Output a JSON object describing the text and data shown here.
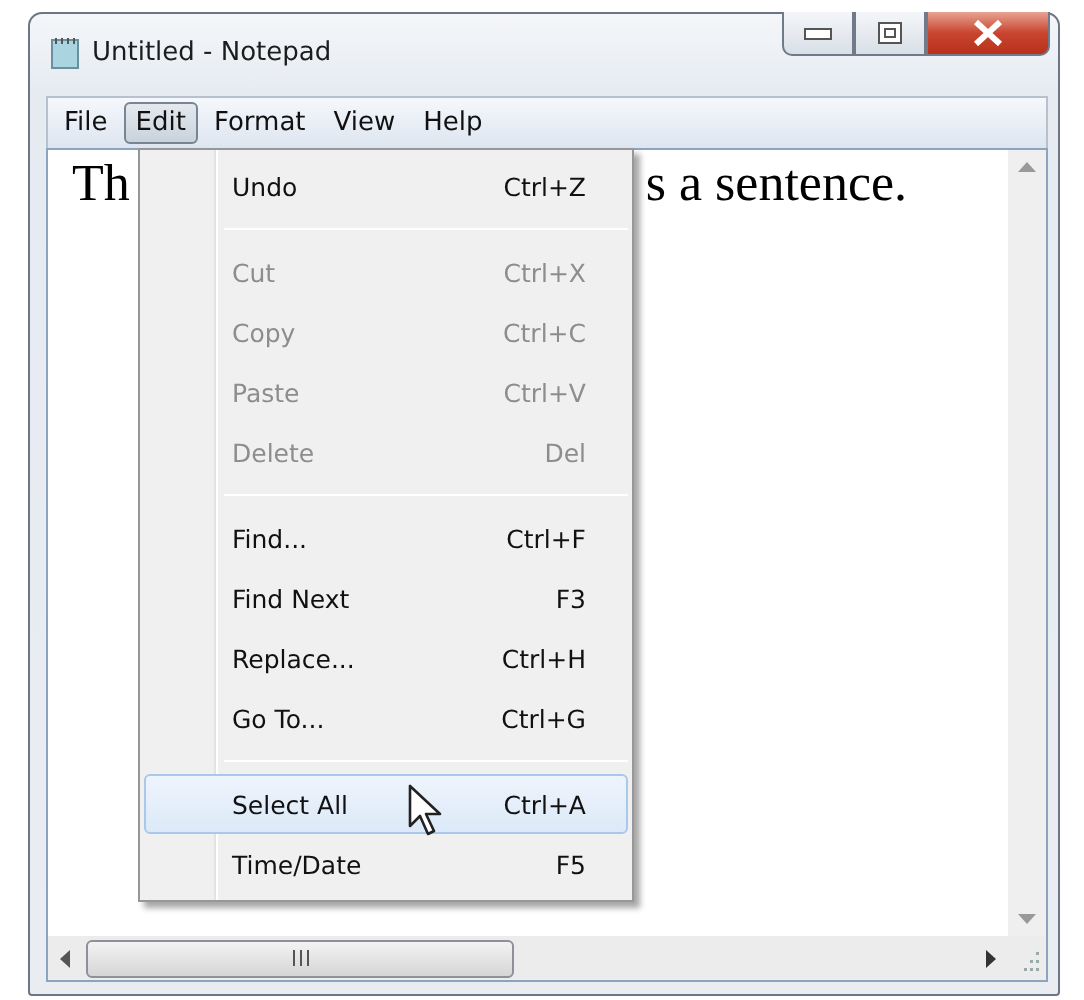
{
  "window": {
    "title": "Untitled - Notepad"
  },
  "menu_bar": [
    {
      "label": "File",
      "selected": false
    },
    {
      "label": "Edit",
      "selected": true
    },
    {
      "label": "Format",
      "selected": false
    },
    {
      "label": "View",
      "selected": false
    },
    {
      "label": "Help",
      "selected": false
    }
  ],
  "document": {
    "text_before_menu": "Th",
    "text_after_menu": "s a sentence."
  },
  "edit_menu": [
    {
      "kind": "item",
      "label": "Undo",
      "shortcut": "Ctrl+Z",
      "disabled": false,
      "selected": false
    },
    {
      "kind": "separator"
    },
    {
      "kind": "item",
      "label": "Cut",
      "shortcut": "Ctrl+X",
      "disabled": true,
      "selected": false
    },
    {
      "kind": "item",
      "label": "Copy",
      "shortcut": "Ctrl+C",
      "disabled": true,
      "selected": false
    },
    {
      "kind": "item",
      "label": "Paste",
      "shortcut": "Ctrl+V",
      "disabled": true,
      "selected": false
    },
    {
      "kind": "item",
      "label": "Delete",
      "shortcut": "Del",
      "disabled": true,
      "selected": false
    },
    {
      "kind": "separator"
    },
    {
      "kind": "item",
      "label": "Find...",
      "shortcut": "Ctrl+F",
      "disabled": false,
      "selected": false
    },
    {
      "kind": "item",
      "label": "Find Next",
      "shortcut": "F3",
      "disabled": false,
      "selected": false
    },
    {
      "kind": "item",
      "label": "Replace...",
      "shortcut": "Ctrl+H",
      "disabled": false,
      "selected": false
    },
    {
      "kind": "item",
      "label": "Go To...",
      "shortcut": "Ctrl+G",
      "disabled": false,
      "selected": false
    },
    {
      "kind": "separator"
    },
    {
      "kind": "item",
      "label": "Select All",
      "shortcut": "Ctrl+A",
      "disabled": false,
      "selected": true
    },
    {
      "kind": "item",
      "label": "Time/Date",
      "shortcut": "F5",
      "disabled": false,
      "selected": false
    }
  ]
}
